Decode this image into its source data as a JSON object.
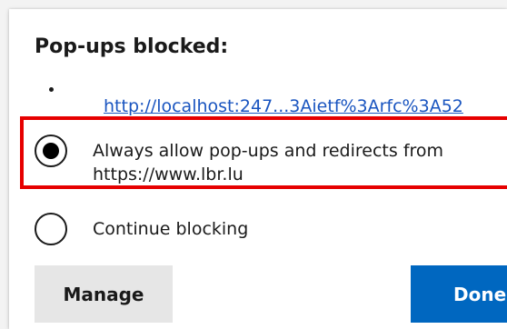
{
  "dialog": {
    "title": "Pop-ups blocked:",
    "blocked_link": "http://localhost:247...3Aietf%3Arfc%3A52",
    "options": [
      {
        "label_line1": "Always allow pop-ups and redirects from",
        "label_line2": "https://www.lbr.lu",
        "selected": true
      },
      {
        "label": "Continue blocking",
        "selected": false
      }
    ],
    "buttons": {
      "manage": "Manage",
      "done": "Done"
    }
  },
  "colors": {
    "link": "#1a55c0",
    "highlight": "#e60000",
    "primary_button": "#0067c0",
    "secondary_button": "#e6e6e6"
  }
}
